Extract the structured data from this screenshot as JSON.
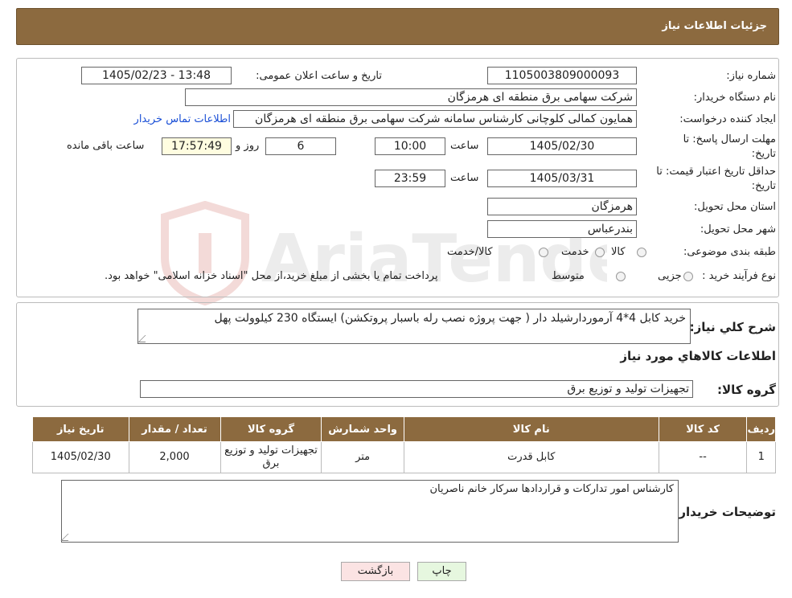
{
  "header": {
    "title": "جزئیات اطلاعات نیاز"
  },
  "form": {
    "need_number": {
      "label": "شماره نیاز:",
      "value": "1105003809000093"
    },
    "announce_datetime": {
      "label": "تاریخ و ساعت اعلان عمومی:",
      "value": "1405/02/23 - 13:48"
    },
    "buyer_org": {
      "label": "نام دستگاه خریدار:",
      "value": "شرکت سهامی برق منطقه ای هرمزگان"
    },
    "requester": {
      "label": "ایجاد کننده درخواست:",
      "value": "همایون کمالی کلوچانی کارشناس سامانه شرکت سهامی برق منطقه ای هرمزگان",
      "contact_link": "اطلاعات تماس خریدار"
    },
    "reply_deadline": {
      "label_line1": "مهلت ارسال پاسخ: تا",
      "label_line2": "تاریخ:",
      "date": "1405/02/30",
      "time_label": "ساعت",
      "time": "10:00",
      "days": "6",
      "days_label": "روز و",
      "remaining": "17:57:49",
      "remaining_label": "ساعت باقی مانده"
    },
    "price_validity": {
      "label_line1": "حداقل تاریخ اعتبار قیمت: تا",
      "label_line2": "تاریخ:",
      "date": "1405/03/31",
      "time_label": "ساعت",
      "time": "23:59"
    },
    "delivery_province": {
      "label": "استان محل تحویل:",
      "value": "هرمزگان"
    },
    "delivery_city": {
      "label": "شهر محل تحویل:",
      "value": "بندرعباس"
    },
    "category": {
      "label": "طبقه بندی موضوعی:",
      "options": [
        "کالا",
        "خدمت",
        "کالا/خدمت"
      ]
    },
    "purchase_process": {
      "label": "نوع فرآیند خرید :",
      "options": [
        "جزیی",
        "متوسط"
      ],
      "note": "پرداخت تمام یا بخشی از مبلغ خرید،از محل \"اسناد خزانه اسلامی\" خواهد بود."
    }
  },
  "summary": {
    "label": "شرح کلي نياز:",
    "value": "خرید کابل 4*4 آرموردارشیلد دار ( جهت پروژه نصب رله باسبار پروتکشن) ایستگاه 230 کیلوولت پهل"
  },
  "goods_section_title": "اطلاعات کالاهاي مورد نياز",
  "goods_group": {
    "label": "گروه کالا:",
    "value": "تجهیزات تولید و توزیع برق"
  },
  "table": {
    "headers": [
      "ردیف",
      "کد کالا",
      "نام کالا",
      "واحد شمارش",
      "گروه کالا",
      "تعداد / مقدار",
      "تاریخ نیاز"
    ],
    "rows": [
      {
        "row": "1",
        "code": "--",
        "name": "کابل قدرت",
        "unit": "متر",
        "group": "تجهیزات تولید و توزیع برق",
        "qty": "2,000",
        "date": "1405/02/30"
      }
    ]
  },
  "buyer_notes": {
    "label": "توضیحات خریدار:",
    "value": "کارشناس امور تدارکات و قراردادها سرکار خانم ناصریان"
  },
  "buttons": {
    "print": "چاپ",
    "back": "بازگشت"
  },
  "watermark": {
    "text": "AriaTender.neT"
  },
  "colors": {
    "header_bg": "#8c6a3f",
    "link": "#1a4fd6",
    "print_btn": "#e6f7df",
    "back_btn": "#fbe3e3"
  }
}
